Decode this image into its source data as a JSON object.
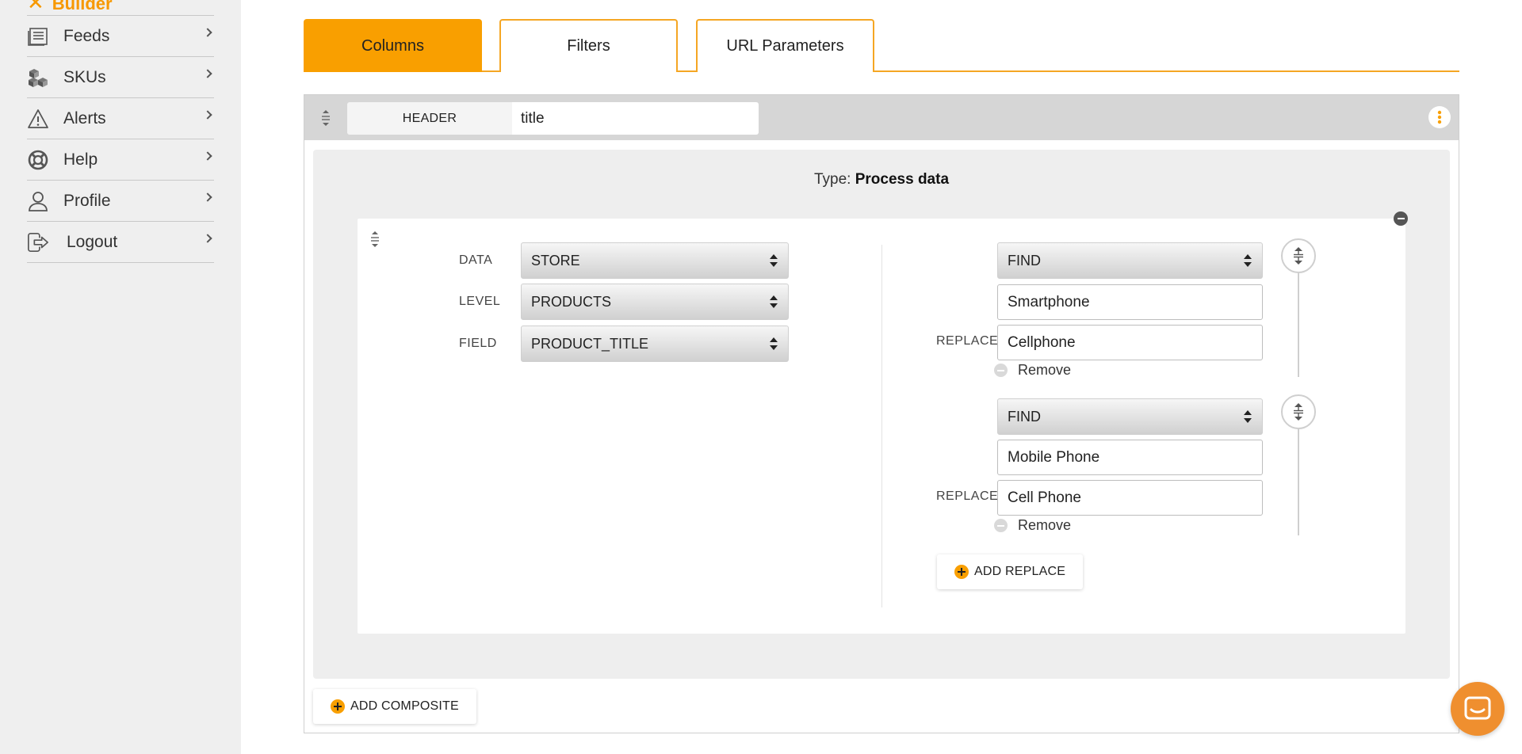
{
  "sidebar": {
    "top_item": "Builder",
    "items": [
      {
        "label": "Feeds",
        "icon": "feed-list-icon"
      },
      {
        "label": "SKUs",
        "icon": "boxes-icon"
      },
      {
        "label": "Alerts",
        "icon": "warning-triangle-icon"
      },
      {
        "label": "Help",
        "icon": "lifebuoy-icon"
      },
      {
        "label": "Profile",
        "icon": "user-icon"
      },
      {
        "label": "Logout",
        "icon": "logout-icon"
      }
    ]
  },
  "tabs": [
    "Columns",
    "Filters",
    "URL Parameters"
  ],
  "column": {
    "header_label": "HEADER",
    "header_value": "title",
    "type_prefix": "Type:",
    "type_value": "Process data"
  },
  "composite": {
    "data_label": "DATA",
    "data_value": "STORE",
    "level_label": "LEVEL",
    "level_value": "PRODUCTS",
    "field_label": "FIELD",
    "field_value": "PRODUCT_TITLE",
    "replaces": [
      {
        "mode": "FIND",
        "find": "Smartphone",
        "replace_label": "REPLACE",
        "replace": "Cellphone",
        "remove_label": "Remove"
      },
      {
        "mode": "FIND",
        "find": "Mobile Phone",
        "replace_label": "REPLACE",
        "replace": "Cell Phone",
        "remove_label": "Remove"
      }
    ],
    "add_replace_label": "ADD REPLACE"
  },
  "add_composite_label": "ADD COMPOSITE",
  "colors": {
    "accent": "#f99f00",
    "chat": "#ef8f2f"
  }
}
